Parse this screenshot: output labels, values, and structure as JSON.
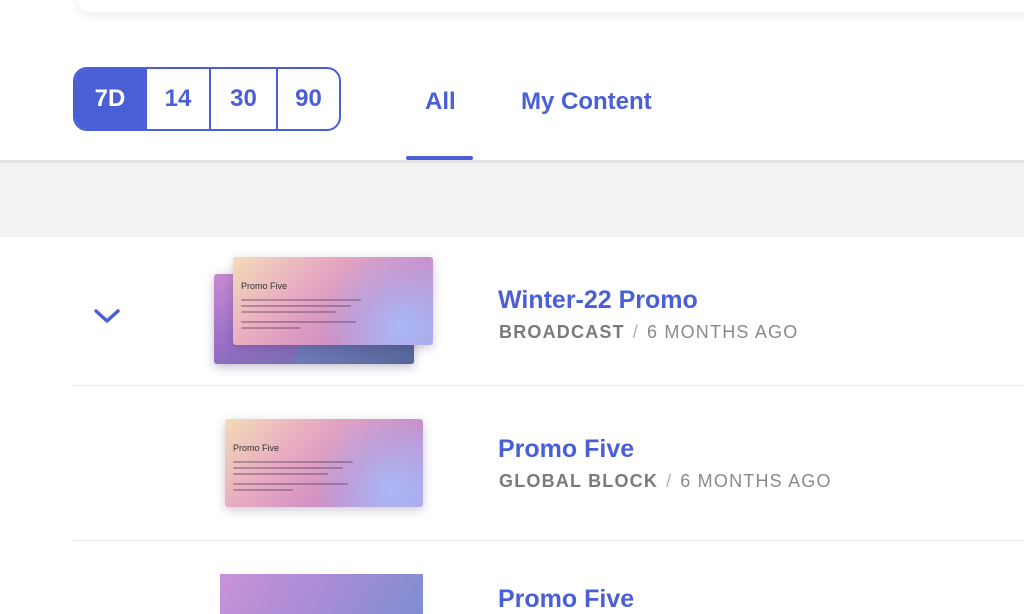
{
  "range": {
    "options": [
      "7D",
      "14",
      "30",
      "90"
    ],
    "selected": "7D"
  },
  "tabs": {
    "all": "All",
    "mine": "My Content",
    "active": "All"
  },
  "items": [
    {
      "title": "Winter-22 Promo",
      "type": "BROADCAST",
      "separator": "/",
      "time": "6 MONTHS AGO",
      "thumb_title": "Promo Five",
      "expanded": true
    },
    {
      "title": "Promo Five",
      "type": "GLOBAL BLOCK",
      "separator": "/",
      "time": "6 MONTHS AGO",
      "thumb_title": "Promo Five"
    },
    {
      "title": "Promo Five"
    }
  ],
  "icons": {
    "expand": "chevron-down-icon"
  },
  "colors": {
    "accent": "#4a5fd6",
    "muted_text": "#8a8a8a",
    "band": "#f2f2f2"
  }
}
